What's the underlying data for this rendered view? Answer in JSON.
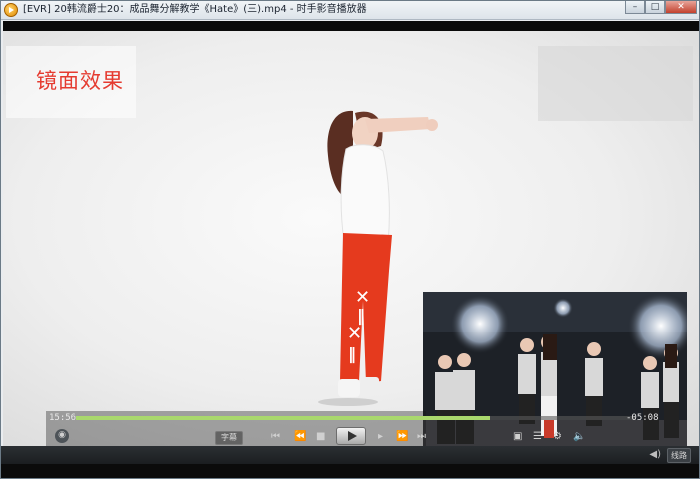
{
  "window": {
    "title": "[EVR] 20韩流爵士20：成品舞分解教学《Hate》(三).mp4 - 时手影音播放器",
    "minimize": "–",
    "maximize": "□",
    "close": "✕"
  },
  "overlay": {
    "caption": "镜面效果"
  },
  "playback": {
    "elapsed": "15:56",
    "remaining": "-05:08",
    "progress": 0.74,
    "subtitle_label": "字幕",
    "route_label": "线路"
  },
  "icons": {
    "app": "player-icon",
    "user": "user-icon",
    "prev": "skip-back-icon",
    "rewind": "rewind-icon",
    "stop": "stop-icon",
    "play": "play-icon",
    "step": "step-forward-icon",
    "forward": "fast-forward-icon",
    "next": "skip-forward-icon",
    "volume": "volume-icon"
  },
  "colors": {
    "caption": "#e53b30",
    "progress": "#a9d86d"
  }
}
